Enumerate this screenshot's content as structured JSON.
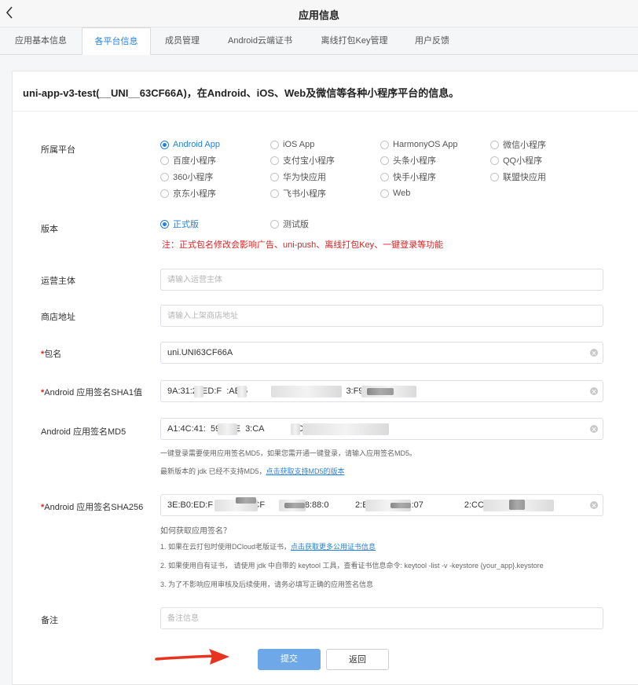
{
  "header": {
    "title": "应用信息"
  },
  "tabs": [
    {
      "label": "应用基本信息"
    },
    {
      "label": "各平台信息",
      "active": true
    },
    {
      "label": "成员管理"
    },
    {
      "label": "Android云端证书"
    },
    {
      "label": "离线打包Key管理"
    },
    {
      "label": "用户反馈"
    }
  ],
  "card": {
    "heading": "uni-app-v3-test(__UNI__63CF66A)，在Android、iOS、Web及微信等各种小程序平台的信息。"
  },
  "platform": {
    "label": "所属平台",
    "options": [
      {
        "label": "Android App",
        "checked": true
      },
      {
        "label": "iOS App"
      },
      {
        "label": "HarmonyOS App"
      },
      {
        "label": "微信小程序"
      },
      {
        "label": "百度小程序"
      },
      {
        "label": "支付宝小程序"
      },
      {
        "label": "头条小程序"
      },
      {
        "label": "QQ小程序"
      },
      {
        "label": "360小程序"
      },
      {
        "label": "华为快应用"
      },
      {
        "label": "快手小程序"
      },
      {
        "label": "联盟快应用"
      },
      {
        "label": "京东小程序"
      },
      {
        "label": "飞书小程序"
      },
      {
        "label": "Web"
      }
    ]
  },
  "version": {
    "label": "版本",
    "options": [
      {
        "label": "正式版",
        "checked": true
      },
      {
        "label": "测试版"
      }
    ],
    "warning": "注：正式包名修改会影响广告、uni-push、离线打包Key、一键登录等功能"
  },
  "fields": {
    "operator": {
      "label": "运营主体",
      "placeholder": "请输入运营主体",
      "value": ""
    },
    "store": {
      "label": "商店地址",
      "placeholder": "请输入上架商店地址",
      "value": ""
    },
    "package": {
      "required": "*",
      "label": "包名",
      "value": "uni.UNI63CF66A"
    },
    "sha1": {
      "required": "*",
      "label": "Android 应用签名SHA1值",
      "value": "9A:31:2  ED:F  :AB:5            :91:91:23              3:F9:3F"
    },
    "md5": {
      "label": "Android 应用签名MD5",
      "value": "A1:4C:41:  59:98:E  3:CA              D:C2"
    },
    "sha256": {
      "required": "*",
      "label": "Android 应用签名SHA256",
      "value": "3E:B0:ED:F      E5:E5:CF      A:4E:18:88:0           2:E6:94:49:ED:07                 2:CC:B7"
    },
    "remark": {
      "label": "备注",
      "placeholder": "备注信息",
      "value": ""
    }
  },
  "help": {
    "md5_line1": "一键登录需要使用应用签名MD5，如果您需开通一键登录，请输入应用签名MD5。",
    "md5_line2_text": "最新版本的 jdk 已经不支持MD5，",
    "md5_line2_link": "点击获取支持MD5的版本",
    "how_title": "如何获取应用签名？",
    "step1_text": "1. 如果在云打包时使用DCloud老版证书，",
    "step1_link": "点击获取更多公用证书信息",
    "step2": "2. 如果使用自有证书， 请使用 jdk 中自带的 keytool 工具，查看证书信息命令: keytool -list -v -keystore {your_app}.keystore",
    "step3": "3. 为了不影响应用审核及后续使用，请务必填写正确的应用签名信息"
  },
  "actions": {
    "submit": "提交",
    "back": "返回"
  },
  "colors": {
    "accent": "#2680d9",
    "danger": "#e02020",
    "primary_button": "#6fa8e8"
  }
}
